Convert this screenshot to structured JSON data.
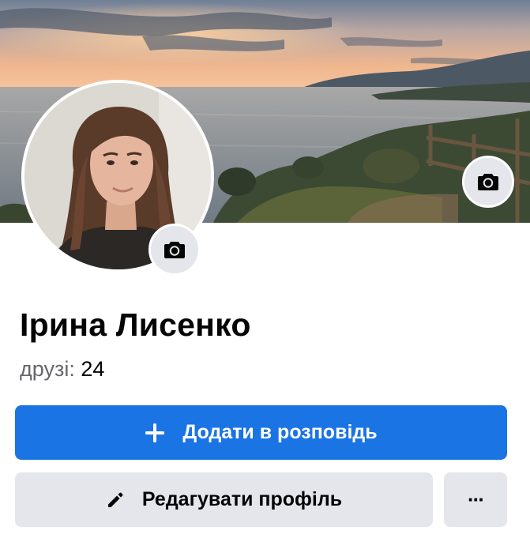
{
  "profile": {
    "name": "Ірина Лисенко",
    "friends_label": "друзі:",
    "friends_count": "24"
  },
  "actions": {
    "add_story_label": "Додати в розповідь",
    "edit_profile_label": "Редагувати профіль",
    "more_label": "···"
  },
  "icons": {
    "cover_camera": "camera-icon",
    "avatar_camera": "camera-icon",
    "add": "plus-icon",
    "edit": "pencil-icon"
  },
  "colors": {
    "primary": "#1b74e4",
    "secondary": "#e4e6eb",
    "text": "#050505",
    "muted": "#65676b"
  }
}
